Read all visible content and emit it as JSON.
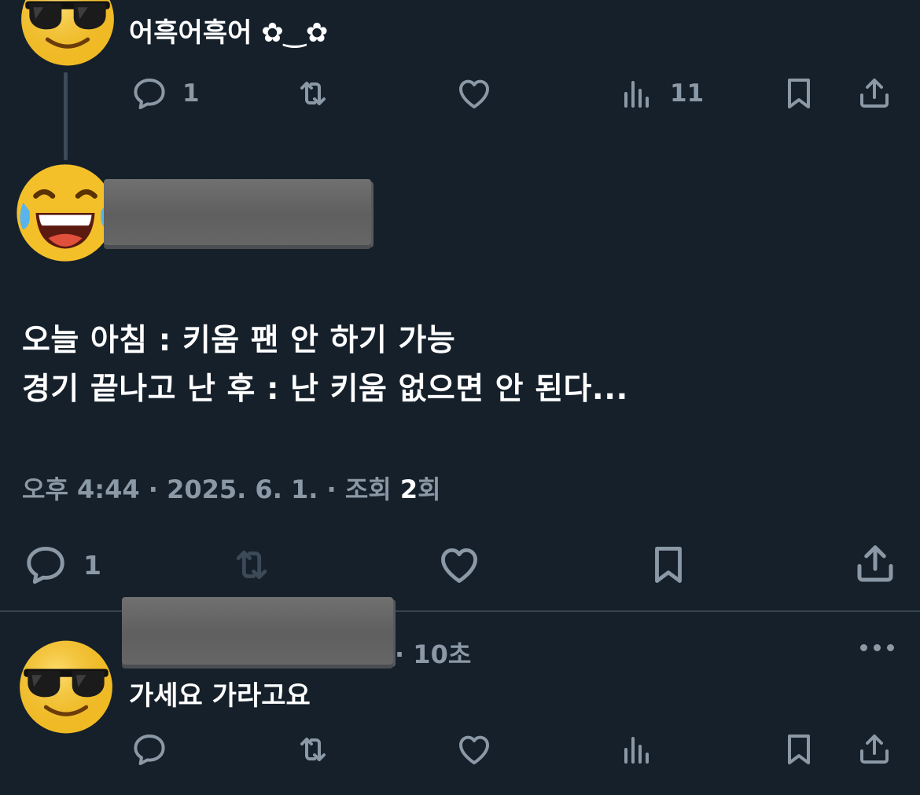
{
  "post1": {
    "text": "어흑어흑어 ✿‿✿",
    "reply_count": "1",
    "views_count": "11"
  },
  "main": {
    "line1": "오늘 아침 : 키움 팬 안 하기 가능",
    "line2": "경기 끝나고 난 후 : 난 키움 없으면 안 된다...",
    "time": "오후 4:44",
    "date": "2025. 6. 1.",
    "views_label": "조회",
    "views_count": "2",
    "views_suffix": "회",
    "reply_count": "1"
  },
  "reply": {
    "time_ago": "10초",
    "text": "가세요 가라고요"
  },
  "colors": {
    "background": "#15202b",
    "muted": "#8b98a5",
    "divider": "#38444d",
    "text": "#ffffff"
  },
  "icons": [
    "reply-icon",
    "retweet-icon",
    "like-icon",
    "views-icon",
    "bookmark-icon",
    "share-icon",
    "more-icon"
  ]
}
